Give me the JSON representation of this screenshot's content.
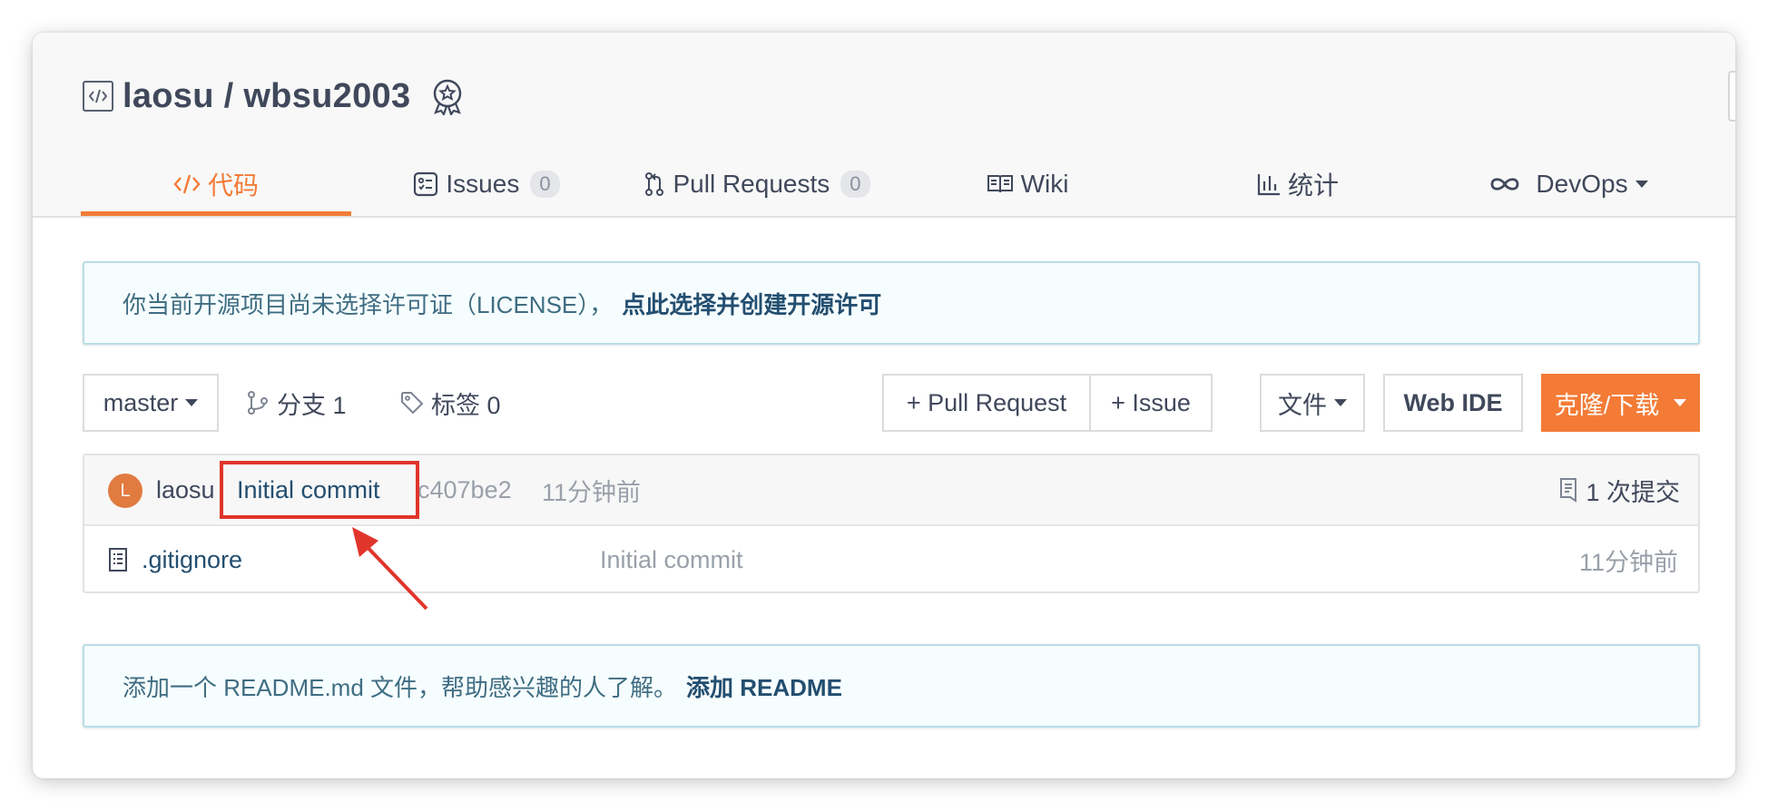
{
  "repo": {
    "title": "laosu / wbsu2003"
  },
  "tabs": [
    {
      "label": "代码",
      "icon": "code-icon",
      "active": true
    },
    {
      "label": "Issues",
      "count": "0",
      "icon": "issues-icon"
    },
    {
      "label": "Pull Requests",
      "count": "0",
      "icon": "pull-request-icon"
    },
    {
      "label": "Wiki",
      "icon": "book-icon"
    },
    {
      "label": "统计",
      "icon": "bar-chart-icon"
    },
    {
      "label": "DevOps",
      "icon": "infinity-icon"
    }
  ],
  "license_notice": {
    "text": "你当前开源项目尚未选择许可证（LICENSE），",
    "action": "点此选择并创建开源许可"
  },
  "toolbar": {
    "branch": "master",
    "branches": "分支 1",
    "tags": "标签 0",
    "new_pr": "+ Pull Request",
    "new_issue": "+ Issue",
    "file_menu": "文件",
    "web_ide": "Web IDE",
    "clone": "克隆/下载"
  },
  "latest_commit": {
    "avatar_letter": "L",
    "author": "laosu",
    "message": "Initial commit",
    "hash": "c407be2",
    "time": "11分钟前",
    "commit_count": "1 次提交"
  },
  "files": [
    {
      "name": ".gitignore",
      "message": "Initial commit",
      "time": "11分钟前"
    }
  ],
  "readme_notice": {
    "text": "添加一个 README.md 文件，帮助感兴趣的人了解。",
    "action": "添加 README"
  },
  "colors": {
    "accent": "#f37b36",
    "link": "#234e70",
    "annotation": "#e0352b"
  }
}
